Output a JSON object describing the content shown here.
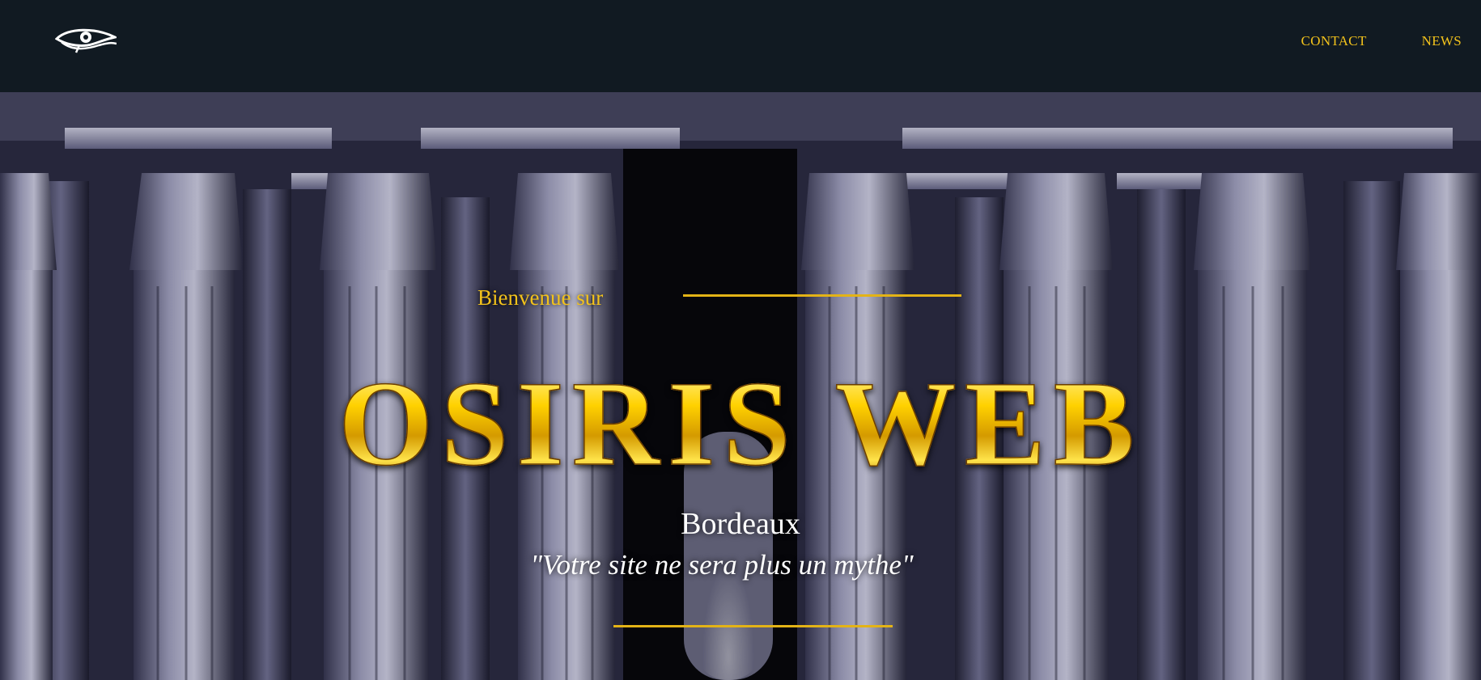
{
  "header": {
    "logo_icon": "eye-of-horus-icon",
    "nav": [
      {
        "label": "CONTACT"
      },
      {
        "label": "NEWS"
      }
    ]
  },
  "hero": {
    "background_image": "egyptian-temple-columns-photo",
    "welcome": "Bienvenue sur",
    "title": "OSIRIS WEB",
    "city": "Bordeaux",
    "motto": "\"Votre site ne sera plus un mythe\""
  },
  "colors": {
    "header_bg": "#111a22",
    "accent_gold": "#f2c21b",
    "text_white": "#ffffff"
  }
}
